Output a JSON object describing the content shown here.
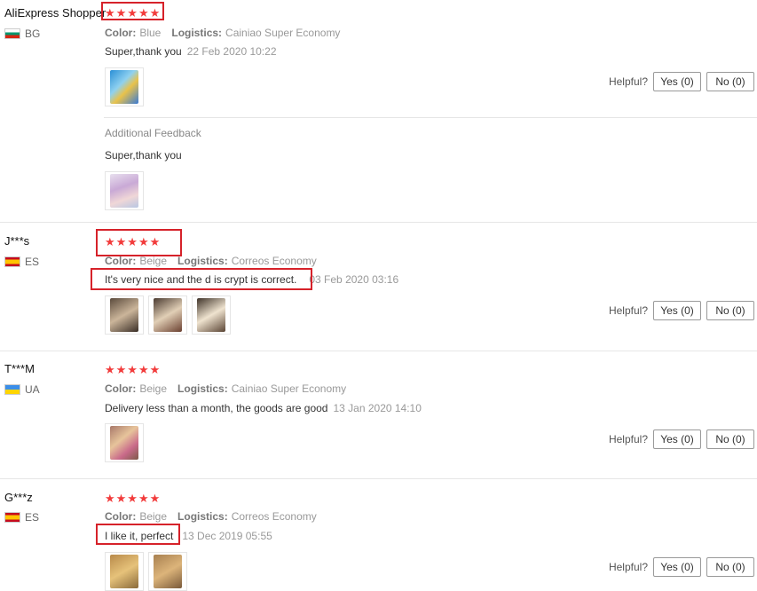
{
  "reviews": [
    {
      "user": "AliExpress Shopper",
      "country": "BG",
      "stars": "★★★★★",
      "color_label": "Color:",
      "color_value": "Blue",
      "logistics_label": "Logistics:",
      "logistics_value": "Cainiao Super Economy",
      "text": "Super,thank you",
      "date": "22 Feb 2020 10:22",
      "helpful_label": "Helpful?",
      "yes_label": "Yes (0)",
      "no_label": "No (0)",
      "additional_title": "Additional Feedback",
      "additional_text": "Super,thank you"
    },
    {
      "user": "J***s",
      "country": "ES",
      "stars": "★★★★★",
      "color_label": "Color:",
      "color_value": "Beige",
      "logistics_label": "Logistics:",
      "logistics_value": "Correos Economy",
      "text": "It's very nice and the d is crypt is correct.",
      "date": "03 Feb 2020 03:16",
      "helpful_label": "Helpful?",
      "yes_label": "Yes (0)",
      "no_label": "No (0)"
    },
    {
      "user": "T***M",
      "country": "UA",
      "stars": "★★★★★",
      "color_label": "Color:",
      "color_value": "Beige",
      "logistics_label": "Logistics:",
      "logistics_value": "Cainiao Super Economy",
      "text": "Delivery less than a month, the goods are good",
      "date": "13 Jan 2020 14:10",
      "helpful_label": "Helpful?",
      "yes_label": "Yes (0)",
      "no_label": "No (0)"
    },
    {
      "user": "G***z",
      "country": "ES",
      "stars": "★★★★★",
      "color_label": "Color:",
      "color_value": "Beige",
      "logistics_label": "Logistics:",
      "logistics_value": "Correos Economy",
      "text": "I like it, perfect",
      "date": "13 Dec 2019 05:55",
      "helpful_label": "Helpful?",
      "yes_label": "Yes (0)",
      "no_label": "No (0)"
    }
  ],
  "colors": {
    "star": "#f23b3b",
    "highlight_box": "#d6222a"
  }
}
